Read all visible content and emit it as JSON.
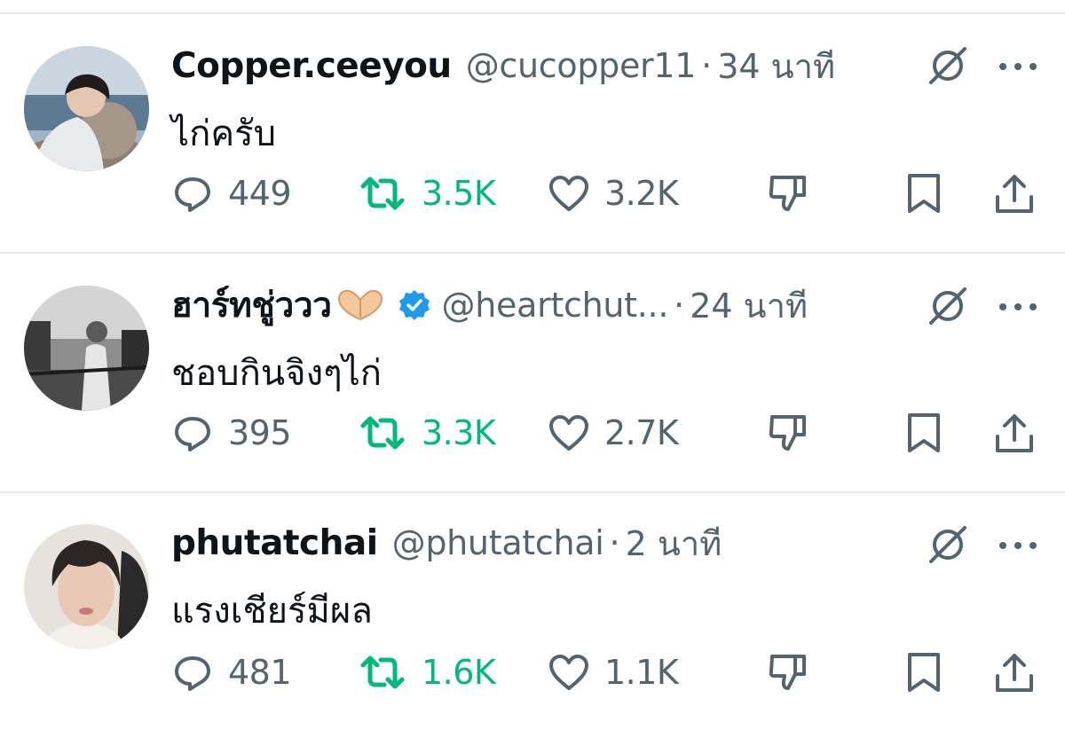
{
  "tweets": [
    {
      "name": "Copper.ceeyou",
      "handle": "@cucopper11",
      "separator": "·",
      "time": "34 นาที",
      "text": "ไก่ครับ",
      "replies": "449",
      "retweets": "3.5K",
      "likes": "3.2K",
      "retweeted": true,
      "verified": false
    },
    {
      "name": "ฮาร์ทชู่ววว",
      "name_emoji": "heart-hands-emoji",
      "handle": "@heartchut...",
      "separator": "·",
      "time": "24 นาที",
      "text": "ชอบกินจิงๆไก่",
      "replies": "395",
      "retweets": "3.3K",
      "likes": "2.7K",
      "retweeted": true,
      "verified": true
    },
    {
      "name": "phutatchai",
      "handle": "@phutatchai",
      "separator": "·",
      "time": "2 นาที",
      "text": "แรงเชียร์มีผล",
      "replies": "481",
      "retweets": "1.6K",
      "likes": "1.1K",
      "retweeted": true,
      "verified": false
    }
  ],
  "colors": {
    "text": "#0f1419",
    "secondary": "#536471",
    "retweet_green": "#00ba7c",
    "verified_blue": "#1d9bf0",
    "divider": "#e6e9eb"
  },
  "icons": [
    "reply-icon",
    "retweet-icon",
    "like-icon",
    "dislike-icon",
    "bookmark-icon",
    "share-icon",
    "grok-icon",
    "more-icon",
    "verified-badge-icon"
  ]
}
